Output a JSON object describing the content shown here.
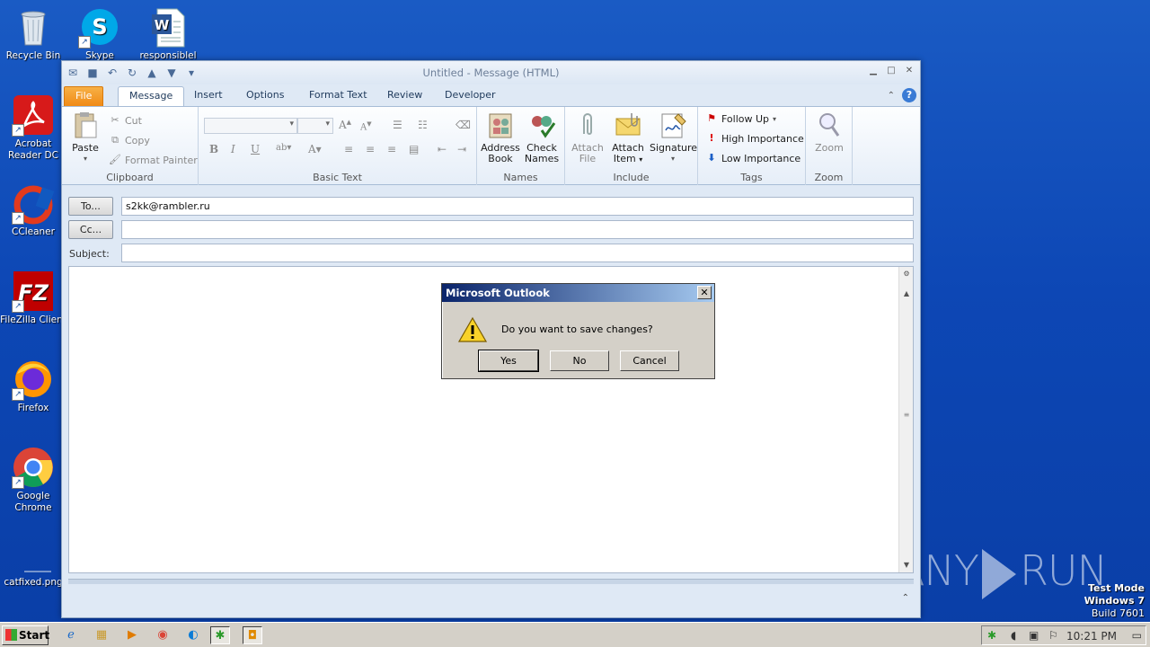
{
  "desktop": {
    "icons": [
      {
        "label": "Recycle Bin"
      },
      {
        "label": "Skype"
      },
      {
        "label": "responsiblel"
      },
      {
        "label": "Acrobat Reader DC"
      },
      {
        "label": "CCleaner"
      },
      {
        "label": "FileZilla Client"
      },
      {
        "label": "Firefox"
      },
      {
        "label": "Google Chrome"
      },
      {
        "label": "catfixed.png"
      }
    ],
    "watermark": {
      "left": "ANY",
      "right": "RUN"
    },
    "test_mode": {
      "line1": "Test Mode",
      "line2": "Windows 7",
      "line3": "Build 7601"
    }
  },
  "window": {
    "title": "Untitled  -  Message (HTML)",
    "tabs": [
      "File",
      "Message",
      "Insert",
      "Options",
      "Format Text",
      "Review",
      "Developer"
    ],
    "active_tab": "Message",
    "ribbon": {
      "clipboard": {
        "label": "Clipboard",
        "paste": "Paste",
        "cut": "Cut",
        "copy": "Copy",
        "format_painter": "Format Painter"
      },
      "basic_text": {
        "label": "Basic Text"
      },
      "names": {
        "label": "Names",
        "address_book_1": "Address",
        "address_book_2": "Book",
        "check_names_1": "Check",
        "check_names_2": "Names"
      },
      "include": {
        "label": "Include",
        "attach_file_1": "Attach",
        "attach_file_2": "File",
        "attach_item_1": "Attach",
        "attach_item_2": "Item",
        "signature": "Signature"
      },
      "tags": {
        "label": "Tags",
        "follow_up": "Follow Up",
        "high_importance": "High Importance",
        "low_importance": "Low Importance"
      },
      "zoom": {
        "label": "Zoom",
        "zoom": "Zoom"
      }
    },
    "compose": {
      "to_button": "To...",
      "to_value": "s2kk@rambler.ru",
      "cc_button": "Cc...",
      "cc_value": "",
      "subject_label": "Subject:",
      "subject_value": ""
    }
  },
  "dialog": {
    "title": "Microsoft Outlook",
    "message": "Do you want to save changes?",
    "yes": "Yes",
    "no": "No",
    "cancel": "Cancel"
  },
  "taskbar": {
    "start": "Start",
    "clock": "10:21 PM"
  }
}
